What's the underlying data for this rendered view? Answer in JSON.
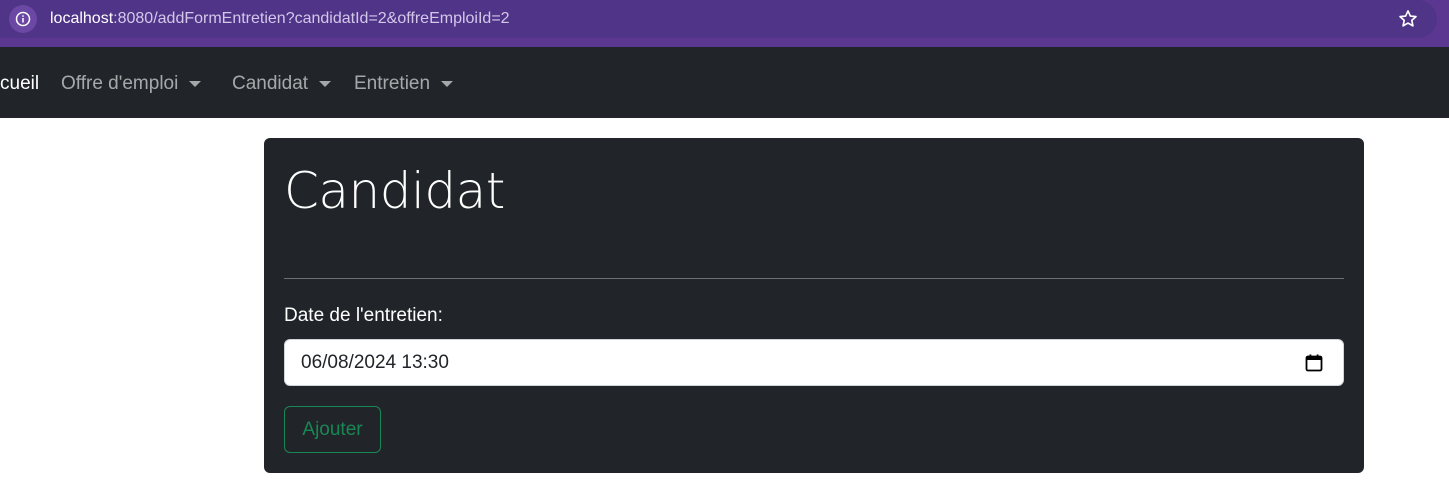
{
  "browser": {
    "url_host": "localhost",
    "url_rest": ":8080/addFormEntretien?candidatId=2&offreEmploiId=2",
    "info_icon": "info-icon",
    "star_icon": "star-icon"
  },
  "navbar": {
    "items": [
      {
        "label": "cueil",
        "active": true
      },
      {
        "label": "Offre d'emploi",
        "dropdown": true
      },
      {
        "label": "Candidat",
        "dropdown": true
      },
      {
        "label": "Entretien",
        "dropdown": true
      }
    ]
  },
  "card": {
    "title": "Candidat",
    "date_label": "Date de l'entretien:",
    "date_value": "06/08/2024 13:30",
    "calendar_icon": "calendar-icon",
    "submit_label": "Ajouter"
  },
  "colors": {
    "browser_bg": "#5b3791",
    "navbar_bg": "#212529",
    "button_success": "#198754"
  }
}
